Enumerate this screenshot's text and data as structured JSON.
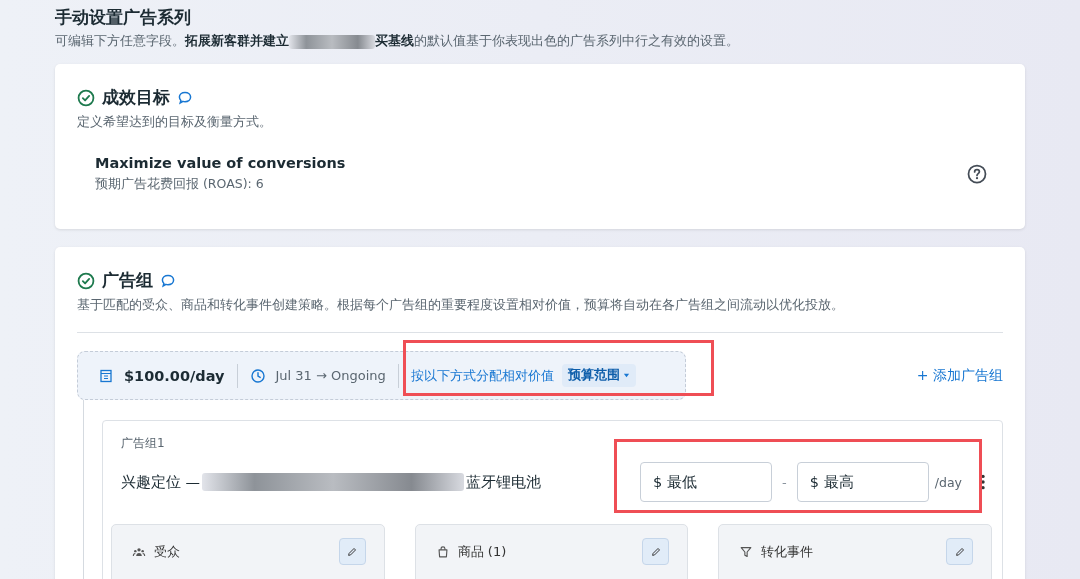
{
  "header": {
    "title": "手动设置广告系列",
    "description_before": "可编辑下方任意字段。",
    "description_bold": "拓展新客群并建立",
    "description_bold_after": "买基线",
    "description_after": "的默认值基于你表现出色的广告系列中行之有效的设置。"
  },
  "sections": [
    {
      "title": "成效目标",
      "complete": true,
      "description": "定义希望达到的目标及衡量方式。",
      "goal": {
        "title": "Maximize value of conversions",
        "detail": "预期广告花费回报 (ROAS): 6"
      }
    },
    {
      "title": "广告组",
      "complete": true,
      "description": "基于匹配的受众、商品和转化事件创建策略。根据每个广告组的重要程度设置相对价值，预算将自动在各广告组之间流动以优化投放。",
      "budget": "$100.00/day",
      "schedule": "Jul 31 → Ongoing",
      "allocation": {
        "label": "按以下方式分配相对价值",
        "option": "预算范围",
        "highlighted": true
      },
      "add_button": "+ 添加广告组",
      "ad_groups": [
        {
          "label": "广告组1",
          "name_before": "兴趣定位 — ",
          "name_after": "蓝牙锂电池",
          "range": {
            "min_placeholder": "$ 最低",
            "separator": "-",
            "max_placeholder": "$ 最高",
            "unit": "/day",
            "highlighted": true
          },
          "panels": [
            {
              "kind": "audience",
              "label": "受众"
            },
            {
              "kind": "products",
              "label": "商品 (1)"
            },
            {
              "kind": "conversion",
              "label": "转化事件"
            }
          ]
        }
      ]
    }
  ]
}
